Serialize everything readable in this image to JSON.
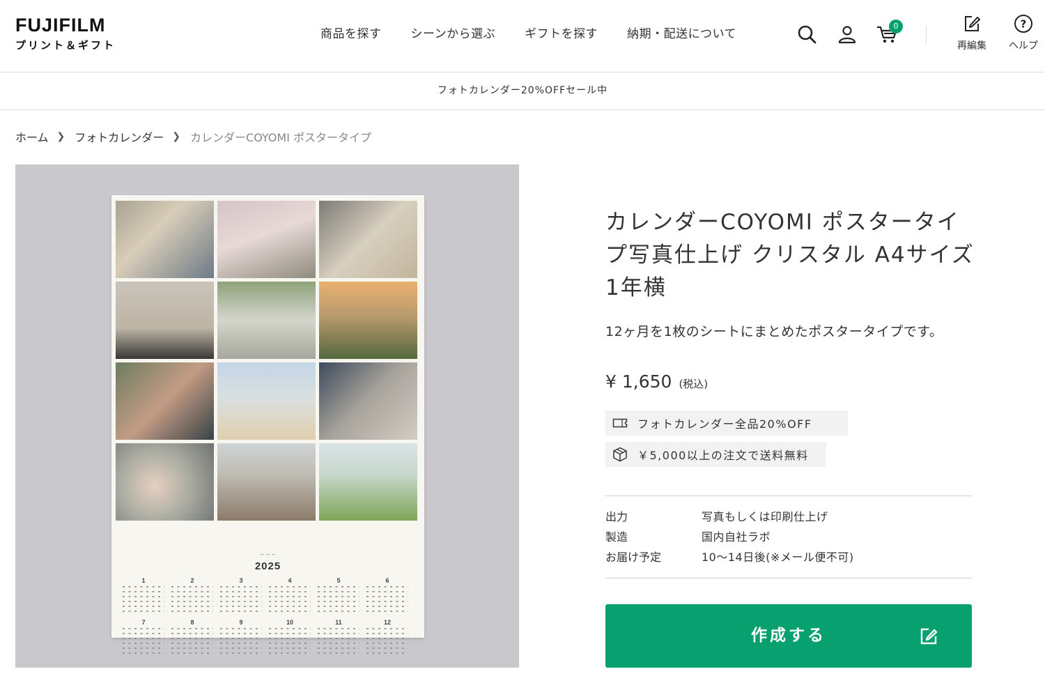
{
  "header": {
    "logo": "FUJIFILM",
    "logo_sub": "プリント＆ギフト",
    "nav": [
      {
        "label": "商品を探す"
      },
      {
        "label": "シーンから選ぶ"
      },
      {
        "label": "ギフトを探す"
      },
      {
        "label": "納期・配送について"
      }
    ],
    "icons": [
      "search-icon",
      "user-icon",
      "cart-icon"
    ],
    "cart_count": "0",
    "reedit_label": "再編集",
    "help_label": "ヘルプ"
  },
  "announcement": "フォトカレンダー20%OFFセール中",
  "breadcrumb": {
    "items": [
      "ホーム",
      "フォトカレンダー"
    ],
    "current": "カレンダーCOYOMI ポスタータイプ"
  },
  "product_image": {
    "year": "2025",
    "months": [
      "1",
      "2",
      "3",
      "4",
      "5",
      "6",
      "7",
      "8",
      "9",
      "10",
      "11",
      "12"
    ]
  },
  "product": {
    "title": "カレンダーCOYOMI ポスタータイプ写真仕上げ クリスタル A4サイズ 1年横",
    "description": "12ヶ月を1枚のシートにまとめたポスタータイプです。",
    "price": "¥ 1,650",
    "price_tax": "(税込)",
    "badges": [
      "フォトカレンダー全品20%OFF",
      "￥5,000以上の注文で送料無料"
    ],
    "specs": [
      {
        "label": "出力",
        "value": "写真もしくは印刷仕上げ"
      },
      {
        "label": "製造",
        "value": "国内自社ラボ"
      },
      {
        "label": "お届け予定",
        "value": "10〜14日後(※メール便不可)"
      }
    ],
    "cta_label": "作成する"
  },
  "colors": {
    "accent": "#07a06e",
    "image_bg": "#c9c8cc"
  }
}
